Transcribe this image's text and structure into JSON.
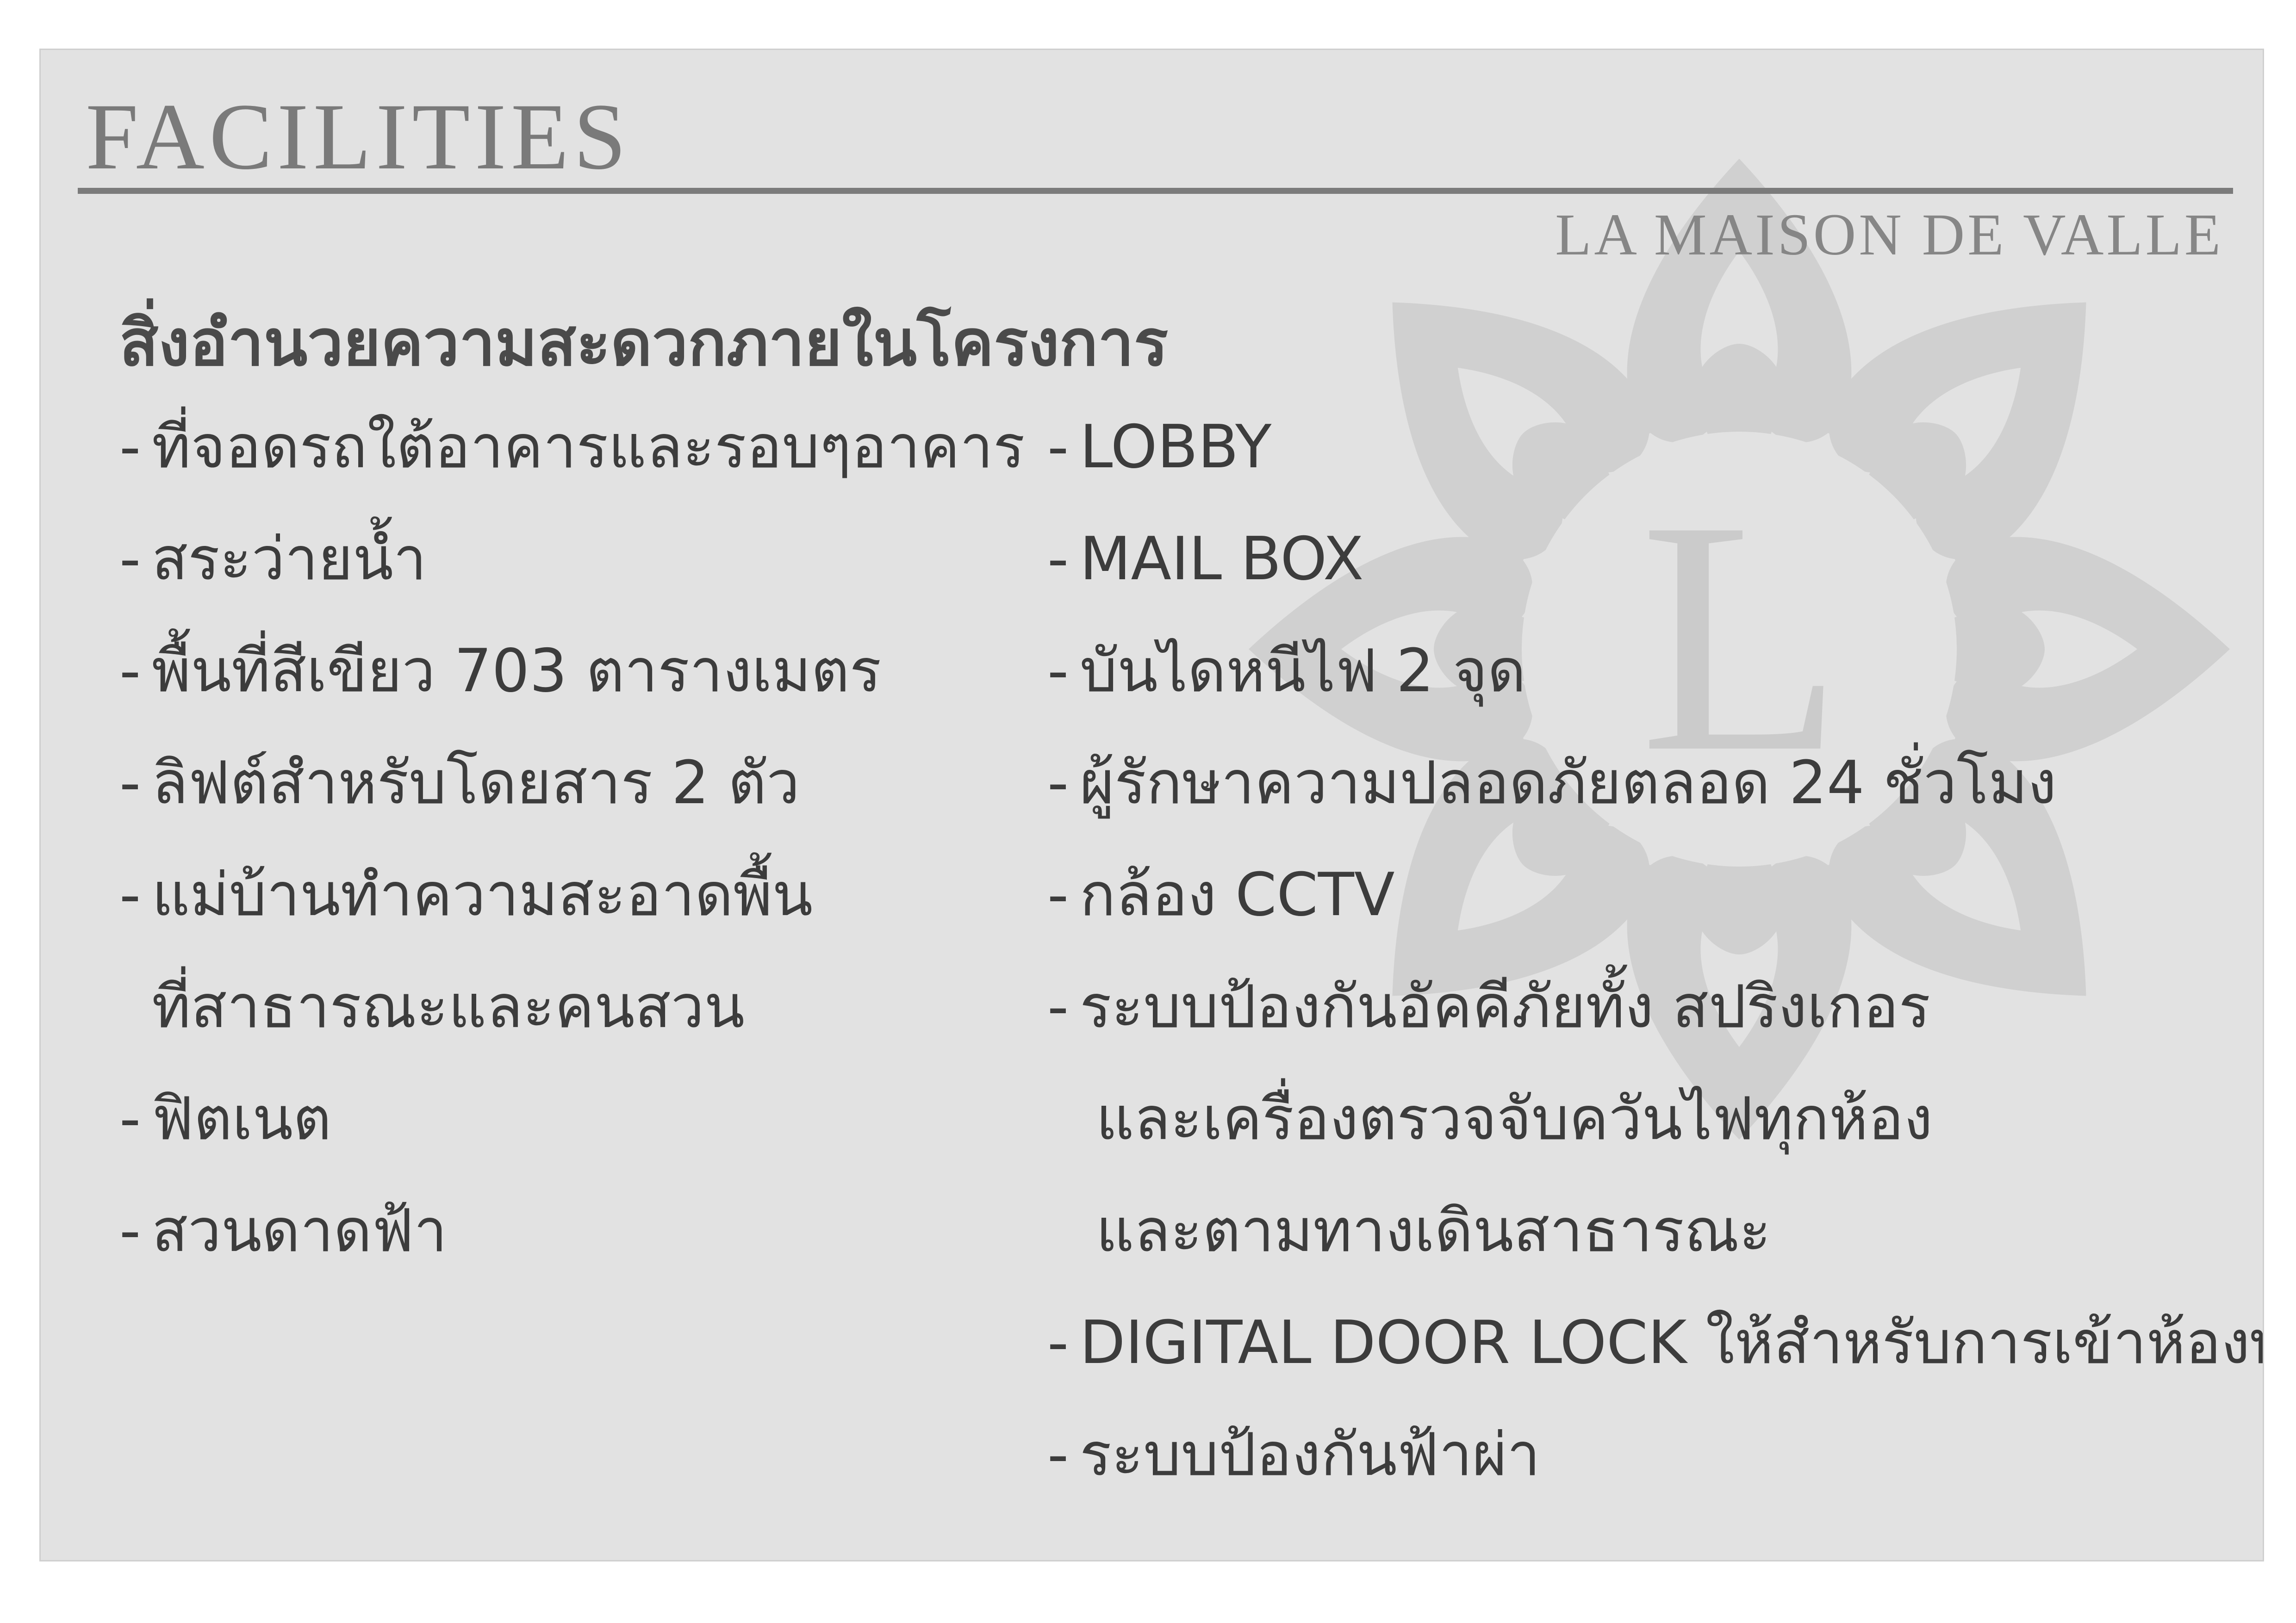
{
  "header": {
    "title": "FACILITIES",
    "brand": "LA MAISON DE VALLE"
  },
  "watermark": {
    "letter": "L",
    "color": "#cdcdcd"
  },
  "section": {
    "heading": "สิ่งอำนวยความสะดวกภายในโครงการ"
  },
  "bullet": "-",
  "left_column": [
    {
      "text": "ที่จอดรถใต้อาคารและรอบๆอาคาร"
    },
    {
      "text": "สระว่ายน้ำ"
    },
    {
      "text": "พื้นที่สีเขียว 703 ตารางเมตร"
    },
    {
      "text": "ลิฟต์สำหรับโดยสาร 2  ตัว"
    },
    {
      "text": "แม่บ้านทำความสะอาดพื้น"
    },
    {
      "text": "ที่สาธารณะและคนสวน"
    },
    {
      "text": "ฟิตเนต"
    },
    {
      "text": "สวนดาดฟ้า"
    }
  ],
  "right_column": [
    {
      "text": "LOBBY"
    },
    {
      "text": "MAIL BOX"
    },
    {
      "text": "บันไดหนีไฟ 2 จุด"
    },
    {
      "text": "ผู้รักษาความปลอดภัยตลอด 24 ชั่วโมง"
    },
    {
      "text": "กล้อง CCTV"
    },
    {
      "text": "ระบบป้องกันอัคคีภัยทั้ง สปริงเกอร"
    },
    {
      "text": "และเครื่องตรวจจับควันไฟทุกห้อง"
    },
    {
      "text": "และตามทางเดินสาธารณะ"
    },
    {
      "text": "DIGITAL DOOR LOCK ให้สำหรับการเข้าห้องพัก"
    },
    {
      "text": "ระบบป้องกันฟ้าผ่า"
    }
  ],
  "colors": {
    "background": "#e2e2e2",
    "title": "#7a7a7a",
    "text": "#3c3c3c"
  }
}
